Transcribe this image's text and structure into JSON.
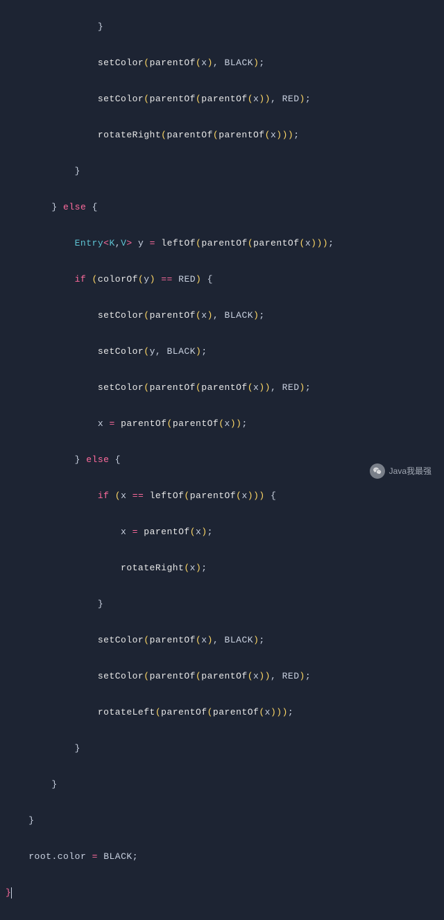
{
  "code": {
    "tokens": {
      "setColor": "setColor",
      "parentOf": "parentOf",
      "rotateRight": "rotateRight",
      "rotateLeft": "rotateLeft",
      "leftOf": "leftOf",
      "colorOf": "colorOf",
      "Entry": "Entry",
      "K": "K",
      "V": "V",
      "else": "else",
      "if": "if",
      "BLACK": "BLACK",
      "RED": "RED",
      "x": "x",
      "y": "y",
      "root": "root",
      "color": "color",
      "eq": "=",
      "deq": "==",
      "comma": ",",
      "semi": ";",
      "dot": ".",
      "lt": "<",
      "gt": ">",
      "lb": "{",
      "rb": "}",
      "lp": "(",
      "rp": ")"
    }
  },
  "watermark": {
    "text": "Java我最强"
  }
}
